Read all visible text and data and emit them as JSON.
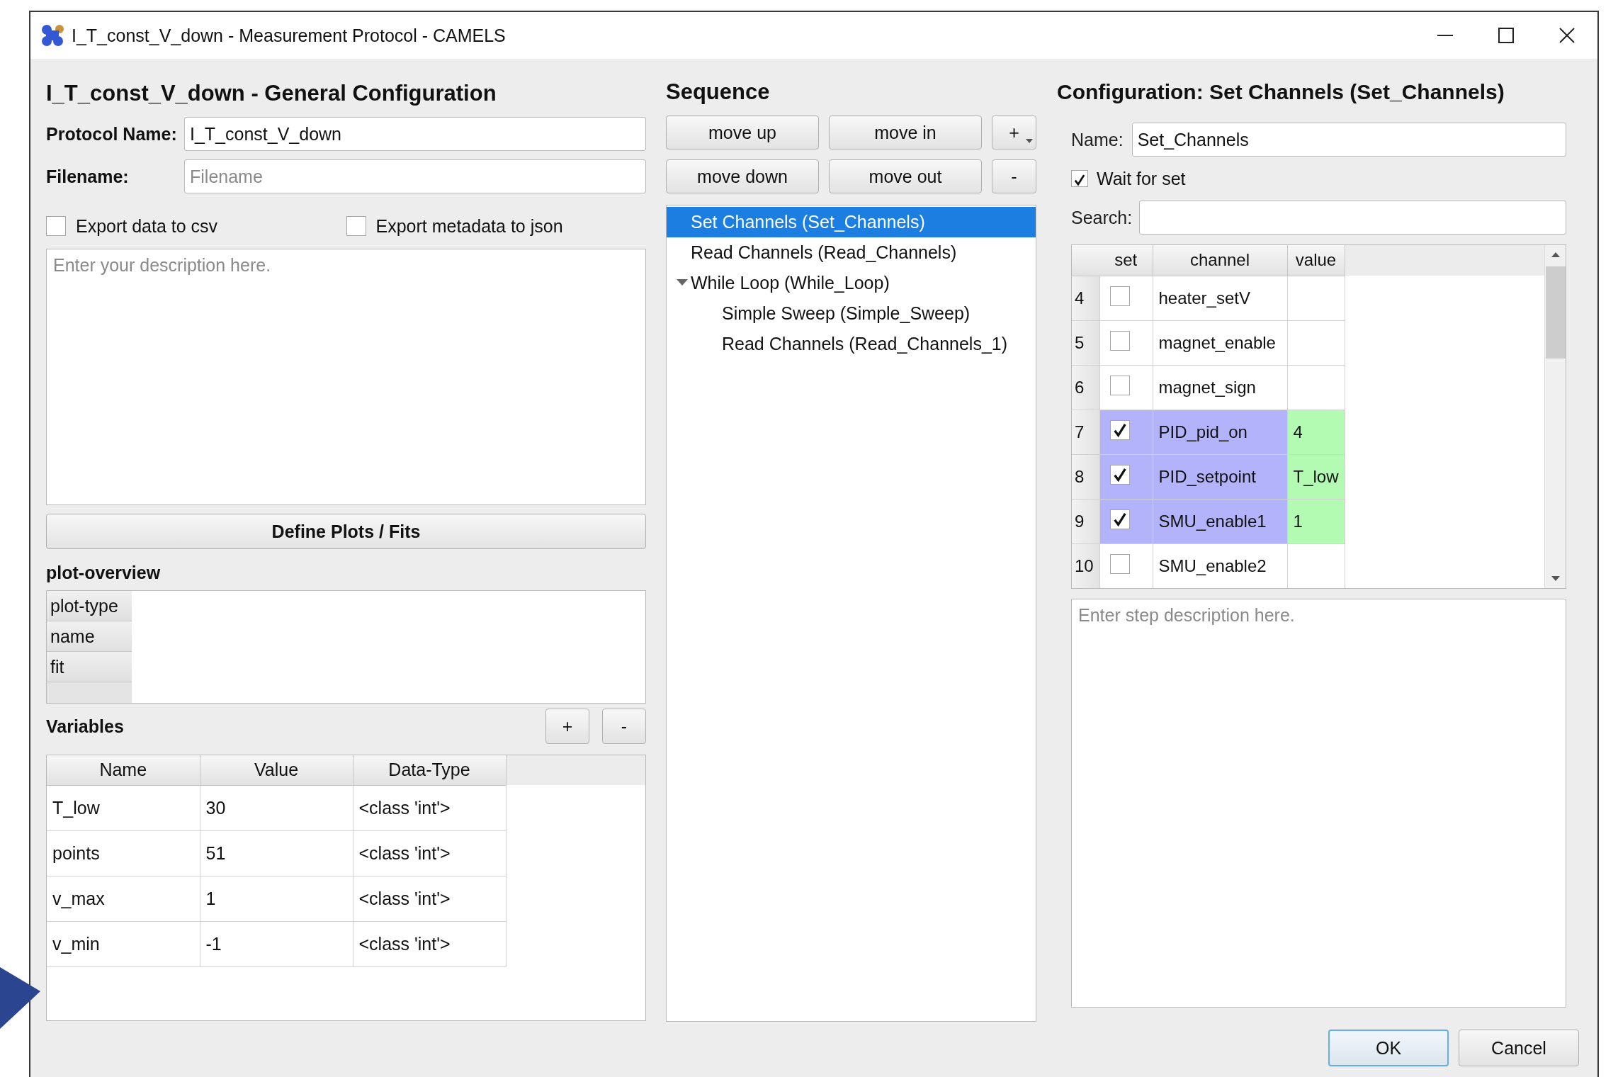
{
  "window": {
    "title": "I_T_const_V_down - Measurement Protocol - CAMELS"
  },
  "general": {
    "heading": "I_T_const_V_down - General Configuration",
    "protocol_name": {
      "label": "Protocol Name:",
      "value": "I_T_const_V_down"
    },
    "filename": {
      "label": "Filename:",
      "placeholder": "Filename"
    },
    "options": [
      {
        "label": "Export data to csv",
        "checked": false
      },
      {
        "label": "Export metadata to json",
        "checked": false
      }
    ],
    "description": {
      "placeholder": "Enter your description here."
    },
    "define_plots_button": "Define Plots / Fits",
    "plot_overview": {
      "title": "plot-overview",
      "row_headers": [
        "plot-type",
        "name",
        "fit"
      ]
    },
    "variables": {
      "title": "Variables",
      "buttons": [
        "+",
        "-"
      ],
      "columns": [
        "Name",
        "Value",
        "Data-Type"
      ],
      "rows": [
        {
          "name": "T_low",
          "value": "30",
          "data_type": "<class 'int'>"
        },
        {
          "name": "points",
          "value": "51",
          "data_type": "<class 'int'>"
        },
        {
          "name": "v_max",
          "value": "1",
          "data_type": "<class 'int'>"
        },
        {
          "name": "v_min",
          "value": "-1",
          "data_type": "<class 'int'>"
        }
      ]
    }
  },
  "sequence": {
    "heading": "Sequence",
    "buttons": [
      {
        "label": "move up",
        "kind": "plain"
      },
      {
        "label": "move in",
        "kind": "plain"
      },
      {
        "label": "+",
        "kind": "menu"
      },
      {
        "label": "move down",
        "kind": "plain"
      },
      {
        "label": "move out",
        "kind": "plain"
      },
      {
        "label": "-",
        "kind": "plain"
      }
    ],
    "tree": [
      {
        "label": "Set Channels (Set_Channels)",
        "selected": true
      },
      {
        "label": "Read Channels (Read_Channels)",
        "selected": false
      },
      {
        "label": "While Loop (While_Loop)",
        "selected": false,
        "expanded": true,
        "children": [
          {
            "label": "Simple Sweep (Simple_Sweep)",
            "selected": false
          },
          {
            "label": "Read Channels (Read_Channels_1)",
            "selected": false
          }
        ]
      }
    ]
  },
  "config": {
    "heading": "Configuration: Set Channels (Set_Channels)",
    "name": {
      "label": "Name:",
      "value": "Set_Channels"
    },
    "wait_for_set": {
      "label": "Wait for set",
      "checked": true
    },
    "search": {
      "label": "Search:"
    },
    "table": {
      "columns": [
        "set",
        "channel",
        "value"
      ],
      "rows": [
        {
          "index": "4",
          "set": false,
          "channel": "heater_setV"
        },
        {
          "index": "5",
          "set": false,
          "channel": "magnet_enable"
        },
        {
          "index": "6",
          "set": false,
          "channel": "magnet_sign"
        },
        {
          "index": "7",
          "set": true,
          "channel": "PID_pid_on",
          "value": "4"
        },
        {
          "index": "8",
          "set": true,
          "channel": "PID_setpoint",
          "value": "T_low"
        },
        {
          "index": "9",
          "set": true,
          "channel": "SMU_enable1",
          "value": "1"
        },
        {
          "index": "10",
          "set": false,
          "channel": "SMU_enable2"
        }
      ]
    },
    "step_description": {
      "placeholder": "Enter step description here."
    }
  },
  "buttons": [
    {
      "label": "OK",
      "default": true
    },
    {
      "label": "Cancel",
      "default": false
    }
  ]
}
